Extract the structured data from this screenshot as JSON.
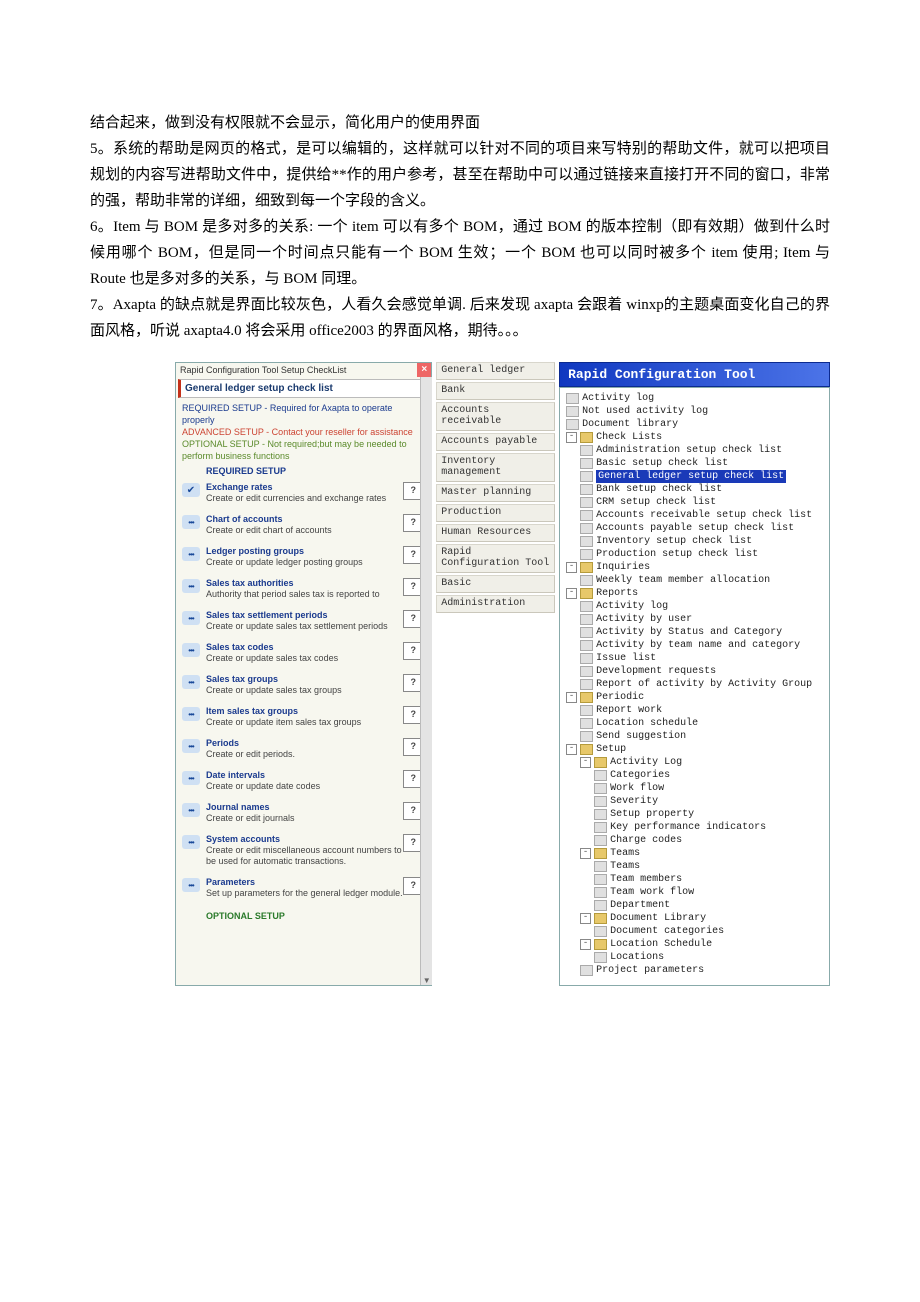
{
  "para": {
    "p1": "结合起来，做到没有权限就不会显示，简化用户的使用界面",
    "p2": "5。系统的帮助是网页的格式，是可以编辑的，这样就可以针对不同的项目来写特别的帮助文件，就可以把项目规划的内容写进帮助文件中，提供给**作的用户参考，甚至在帮助中可以通过链接来直接打开不同的窗口，非常的强，帮助非常的详细，细致到每一个字段的含义。",
    "p3": "6。Item 与 BOM 是多对多的关系: 一个 item 可以有多个 BOM，通过 BOM 的版本控制（即有效期）做到什么时候用哪个 BOM，但是同一个时间点只能有一个 BOM 生效；一个 BOM 也可以同时被多个 item 使用; Item 与 Route 也是多对多的关系，与 BOM 同理。",
    "p4": "7。Axapta 的缺点就是界面比较灰色，人看久会感觉单调. 后来发现 axapta 会跟着 winxp的主题桌面变化自己的界面风格，听说 axapta4.0 将会采用 office2003 的界面风格，期待。。。"
  },
  "left": {
    "title": "Rapid Configuration Tool Setup CheckList",
    "headline": "General ledger setup check list",
    "legend": {
      "l1": "REQUIRED SETUP - Required for Axapta to operate properly",
      "l2": "ADVANCED SETUP - Contact your reseller for assistance",
      "l3": "OPTIONAL SETUP - Not required;but may be needed to",
      "l4": "perform business functions"
    },
    "req_title": "REQUIRED SETUP",
    "opt_title": "OPTIONAL SETUP",
    "tasks": [
      {
        "status": "done",
        "title": "Exchange rates",
        "desc": "Create or edit currencies and exchange rates"
      },
      {
        "status": "todo",
        "title": "Chart of accounts",
        "desc": "Create or edit chart of accounts"
      },
      {
        "status": "todo",
        "title": "Ledger posting groups",
        "desc": "Create or update ledger posting groups"
      },
      {
        "status": "todo",
        "title": "Sales tax authorities",
        "desc": "Authority that period sales tax is reported to"
      },
      {
        "status": "todo",
        "title": "Sales tax settlement periods",
        "desc": "Create or update sales tax settlement periods"
      },
      {
        "status": "todo",
        "title": "Sales tax codes",
        "desc": "Create or update sales tax codes"
      },
      {
        "status": "todo",
        "title": "Sales tax groups",
        "desc": "Create or update sales tax groups"
      },
      {
        "status": "todo",
        "title": "Item sales tax groups",
        "desc": "Create or update item sales tax groups"
      },
      {
        "status": "todo",
        "title": "Periods",
        "desc": "Create or edit periods."
      },
      {
        "status": "todo",
        "title": "Date intervals",
        "desc": "Create or update date codes"
      },
      {
        "status": "todo",
        "title": "Journal names",
        "desc": "Create or edit journals"
      },
      {
        "status": "todo",
        "title": "System accounts",
        "desc": "Create or edit miscellaneous account numbers to be used for automatic transactions."
      },
      {
        "status": "todo",
        "title": "Parameters",
        "desc": "Set up parameters for the general ledger module."
      }
    ]
  },
  "mid": [
    "General ledger",
    "Bank",
    "Accounts receivable",
    "Accounts payable",
    "Inventory management",
    "Master planning",
    "Production",
    "Human Resources",
    "Rapid Configuration Tool",
    "Basic",
    "Administration"
  ],
  "right": {
    "title": "Rapid Configuration Tool",
    "nodes": [
      {
        "d": 1,
        "t": "doc",
        "l": "Activity log"
      },
      {
        "d": 1,
        "t": "doc",
        "l": "Not used activity log"
      },
      {
        "d": 1,
        "t": "doc",
        "l": "Document library"
      },
      {
        "d": 1,
        "t": "folder",
        "tg": "-",
        "l": "Check Lists"
      },
      {
        "d": 2,
        "t": "doc",
        "l": "Administration setup check list"
      },
      {
        "d": 2,
        "t": "doc",
        "l": "Basic setup check list"
      },
      {
        "d": 2,
        "t": "doc",
        "l": "General ledger setup check list",
        "sel": true
      },
      {
        "d": 2,
        "t": "doc",
        "l": "Bank setup check list"
      },
      {
        "d": 2,
        "t": "doc",
        "l": "CRM setup check list"
      },
      {
        "d": 2,
        "t": "doc",
        "l": "Accounts receivable setup check list"
      },
      {
        "d": 2,
        "t": "doc",
        "l": "Accounts payable setup check list"
      },
      {
        "d": 2,
        "t": "doc",
        "l": "Inventory setup check list"
      },
      {
        "d": 2,
        "t": "doc",
        "l": "Production setup check list"
      },
      {
        "d": 1,
        "t": "folder",
        "tg": "-",
        "l": "Inquiries"
      },
      {
        "d": 2,
        "t": "doc",
        "l": "Weekly team member allocation"
      },
      {
        "d": 1,
        "t": "folder",
        "tg": "-",
        "l": "Reports"
      },
      {
        "d": 2,
        "t": "doc",
        "l": "Activity log"
      },
      {
        "d": 2,
        "t": "doc",
        "l": "Activity by user"
      },
      {
        "d": 2,
        "t": "doc",
        "l": "Activity by Status and Category"
      },
      {
        "d": 2,
        "t": "doc",
        "l": "Activity by team name and category"
      },
      {
        "d": 2,
        "t": "doc",
        "l": "Issue list"
      },
      {
        "d": 2,
        "t": "doc",
        "l": "Development requests"
      },
      {
        "d": 2,
        "t": "doc",
        "l": "Report of activity by Activity Group"
      },
      {
        "d": 1,
        "t": "folder",
        "tg": "-",
        "l": "Periodic"
      },
      {
        "d": 2,
        "t": "doc",
        "l": "Report work"
      },
      {
        "d": 2,
        "t": "doc",
        "l": "Location schedule"
      },
      {
        "d": 2,
        "t": "doc",
        "l": "Send suggestion"
      },
      {
        "d": 1,
        "t": "folder",
        "tg": "-",
        "l": "Setup"
      },
      {
        "d": 2,
        "t": "folder",
        "tg": "-",
        "l": "Activity Log"
      },
      {
        "d": 3,
        "t": "doc",
        "l": "Categories"
      },
      {
        "d": 3,
        "t": "doc",
        "l": "Work flow"
      },
      {
        "d": 3,
        "t": "doc",
        "l": "Severity"
      },
      {
        "d": 3,
        "t": "doc",
        "l": "Setup property"
      },
      {
        "d": 3,
        "t": "doc",
        "l": "Key performance indicators"
      },
      {
        "d": 3,
        "t": "doc",
        "l": "Charge codes"
      },
      {
        "d": 2,
        "t": "folder",
        "tg": "-",
        "l": "Teams"
      },
      {
        "d": 3,
        "t": "doc",
        "l": "Teams"
      },
      {
        "d": 3,
        "t": "doc",
        "l": "Team members"
      },
      {
        "d": 3,
        "t": "doc",
        "l": "Team work flow"
      },
      {
        "d": 3,
        "t": "doc",
        "l": "Department"
      },
      {
        "d": 2,
        "t": "folder",
        "tg": "-",
        "l": "Document Library"
      },
      {
        "d": 3,
        "t": "doc",
        "l": "Document categories"
      },
      {
        "d": 2,
        "t": "folder",
        "tg": "-",
        "l": "Location Schedule"
      },
      {
        "d": 3,
        "t": "doc",
        "l": "Locations"
      },
      {
        "d": 2,
        "t": "doc",
        "l": "Project parameters"
      }
    ]
  }
}
